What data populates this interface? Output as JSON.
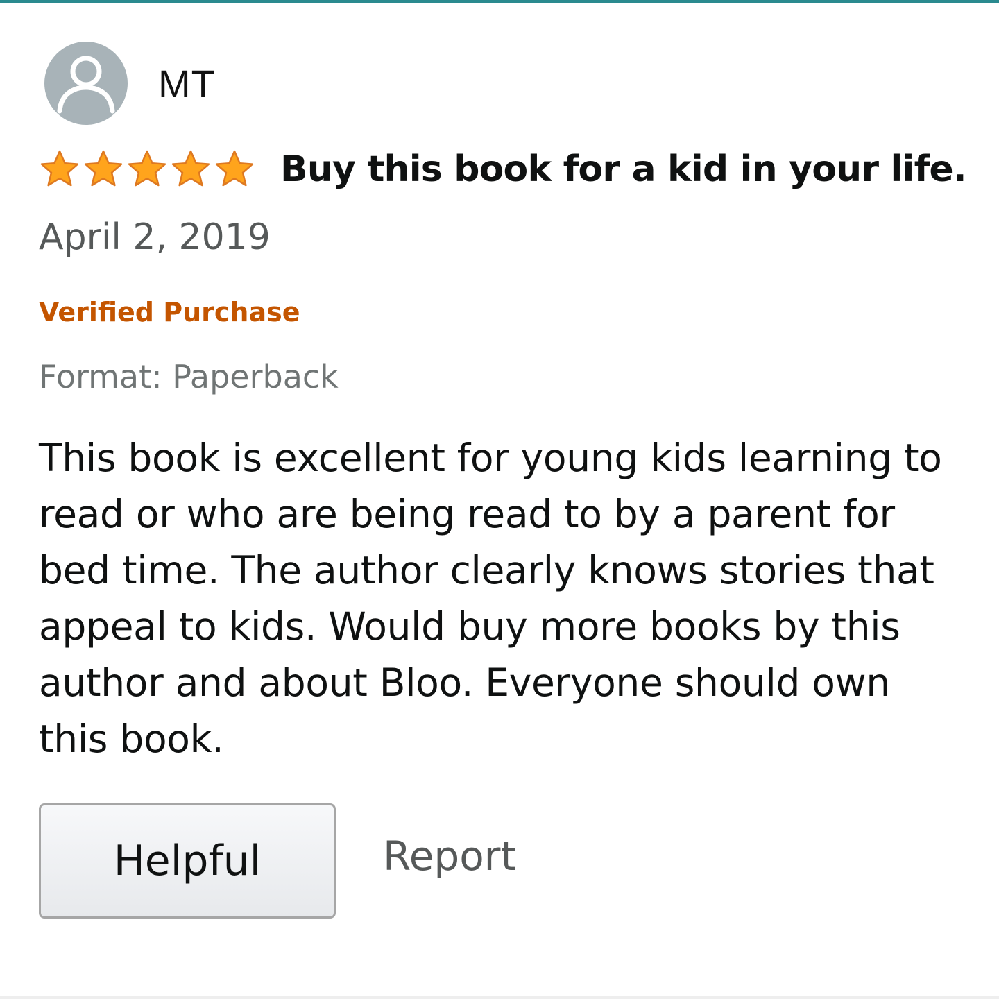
{
  "review": {
    "reviewer_name": "MT",
    "rating": 5,
    "rating_max": 5,
    "title": "Buy this book for a kid in your life.",
    "date": "April 2, 2019",
    "badge": "Verified Purchase",
    "format": "Format: Paperback",
    "body": "This book is excellent for young kids learning to read or who are being read to by a parent for bed time. The author clearly knows stories that appeal to kids. Would buy more books by this author and about Bloo. Everyone should own this book."
  },
  "actions": {
    "helpful_label": "Helpful",
    "report_label": "Report"
  },
  "icons": {
    "avatar": "default-user-icon",
    "star": "star-icon"
  },
  "colors": {
    "top_rule": "#2a8a8f",
    "star_fill": "#ffa41c",
    "star_stroke": "#de7921",
    "badge": "#c45500",
    "secondary_text": "#565959"
  }
}
